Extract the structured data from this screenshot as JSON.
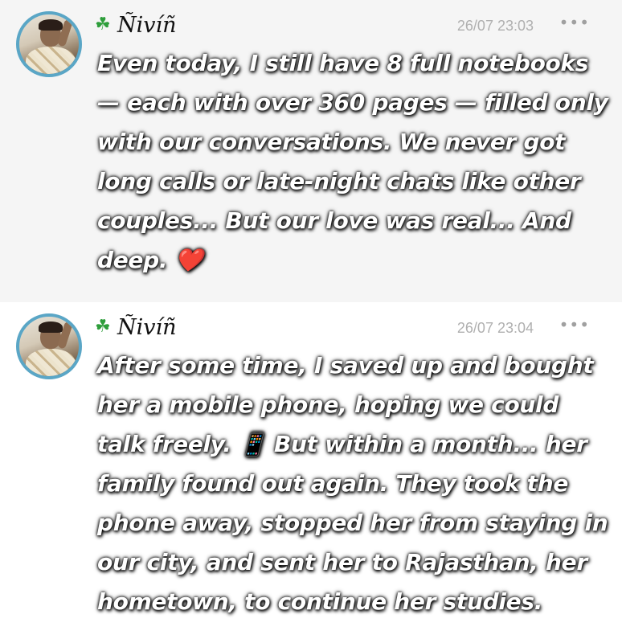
{
  "messages": [
    {
      "sender": "Ñivíñ",
      "clover": "☘",
      "time": "26/07 23:03",
      "more": "•••",
      "text": "Even today, I still have 8 full notebooks — each with over 360 pages — filled only with our conversations. We never got long calls or late-night chats like other couples... But our love was real... And deep. ❤️"
    },
    {
      "sender": "Ñivíñ",
      "clover": "☘",
      "time": "26/07 23:04",
      "more": "•••",
      "text": "After some time, I saved up and bought her a mobile phone, hoping we could talk freely. 📱 But within a month... her family found out again. They took the phone away, stopped her from staying in our city, and sent her to Rajasthan, her hometown, to continue her studies."
    }
  ],
  "icons": {
    "avatar": "avatar-photo",
    "clover": "clover-icon",
    "more": "more-options-icon"
  },
  "colors": {
    "avatar_border": "#5aa6c6",
    "clover": "#2e9e3b",
    "timestamp": "#b0b0b0",
    "message_text": "#ffffff"
  }
}
